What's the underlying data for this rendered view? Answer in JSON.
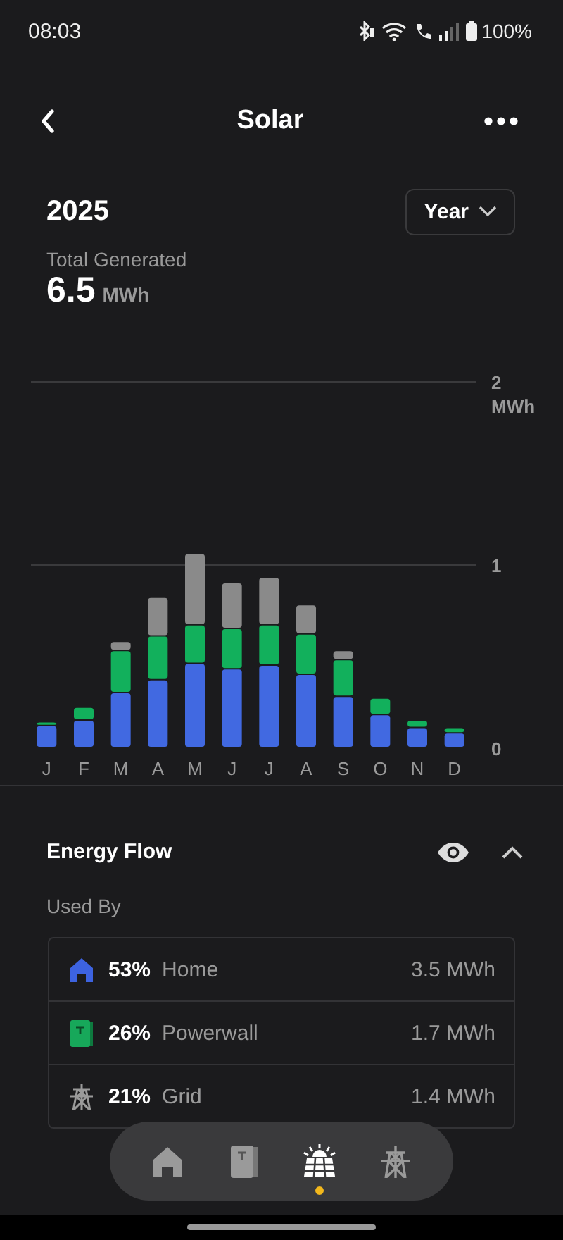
{
  "status_bar": {
    "time": "08:03",
    "battery": "100%"
  },
  "header": {
    "title": "Solar"
  },
  "period": {
    "year": "2025",
    "range": "Year"
  },
  "total": {
    "label": "Total Generated",
    "value": "6.5",
    "unit": "MWh"
  },
  "chart_data": {
    "type": "bar",
    "stacked": true,
    "categories": [
      "J",
      "F",
      "M",
      "A",
      "M",
      "J",
      "J",
      "A",
      "S",
      "O",
      "N",
      "D"
    ],
    "ylim": [
      0,
      2
    ],
    "yticks": [
      0,
      1,
      {
        "value": 2,
        "label": "2 MWh"
      }
    ],
    "series": [
      {
        "color": "#4169e1",
        "values": [
          0.12,
          0.15,
          0.3,
          0.37,
          0.46,
          0.43,
          0.45,
          0.4,
          0.28,
          0.18,
          0.11,
          0.08
        ]
      },
      {
        "color": "#12b05c",
        "values": [
          0.02,
          0.07,
          0.23,
          0.24,
          0.21,
          0.22,
          0.22,
          0.22,
          0.2,
          0.09,
          0.04,
          0.03
        ]
      },
      {
        "color": "#8a8a8a",
        "values": [
          0,
          0,
          0.05,
          0.21,
          0.39,
          0.25,
          0.26,
          0.16,
          0.05,
          0,
          0,
          0
        ]
      }
    ]
  },
  "energy_flow": {
    "title": "Energy Flow",
    "expanded": true,
    "subtitle": "Used By",
    "rows": [
      {
        "kind": "home",
        "percent": "53%",
        "name": "Home",
        "amount": "3.5 MWh"
      },
      {
        "kind": "powerwall",
        "percent": "26%",
        "name": "Powerwall",
        "amount": "1.7 MWh"
      },
      {
        "kind": "grid",
        "percent": "21%",
        "name": "Grid",
        "amount": "1.4 MWh"
      }
    ]
  },
  "nav": [
    {
      "kind": "home",
      "selected": false
    },
    {
      "kind": "powerwall",
      "selected": false
    },
    {
      "kind": "solar",
      "selected": true
    },
    {
      "kind": "grid",
      "selected": false
    }
  ]
}
